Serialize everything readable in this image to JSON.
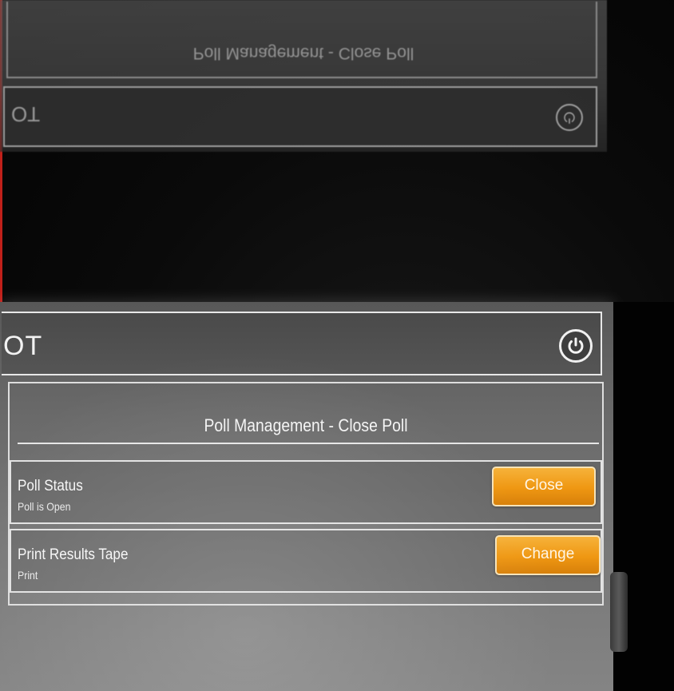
{
  "reflection": {
    "header_text": "OT",
    "title": "Poll Management - Close Poll",
    "power_icon": "power-icon"
  },
  "header": {
    "title": "OT",
    "power_icon": "power-icon"
  },
  "panel": {
    "title": "Poll Management - Close Poll",
    "rows": [
      {
        "label": "Poll Status",
        "value": "Poll is Open",
        "button": "Close"
      },
      {
        "label": "Print Results Tape",
        "value": "Print",
        "button": "Change"
      }
    ]
  },
  "colors": {
    "button_orange": "#ef9712",
    "screen_gray": "#6a6a6a",
    "border_light": "#e2e2e2"
  }
}
